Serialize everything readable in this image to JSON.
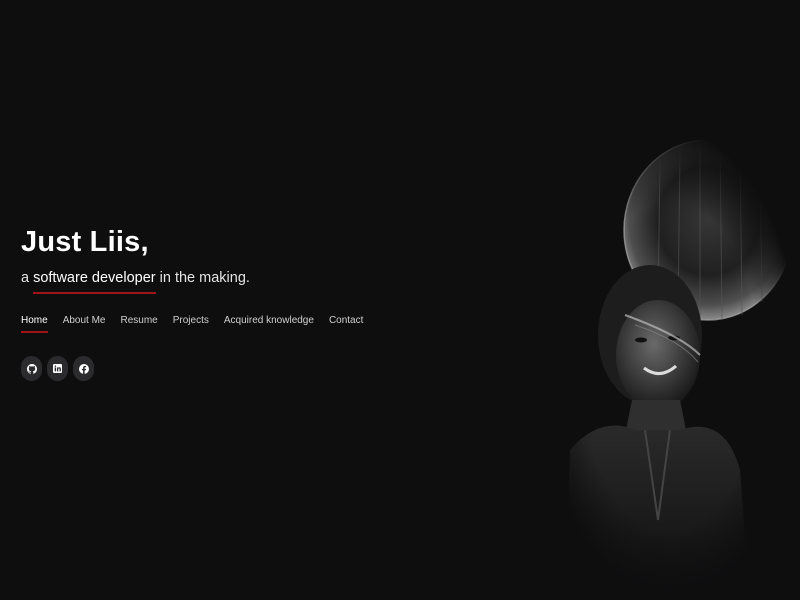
{
  "hero": {
    "name": "Just Liis,",
    "tagline_prefix": "a ",
    "tagline_highlight": "software developer",
    "tagline_suffix": " in the making.",
    "accent_color": "#a11418"
  },
  "nav": {
    "items": [
      {
        "label": "Home",
        "active": true
      },
      {
        "label": "About Me",
        "active": false
      },
      {
        "label": "Resume",
        "active": false
      },
      {
        "label": "Projects",
        "active": false
      },
      {
        "label": "Acquired knowledge",
        "active": false
      },
      {
        "label": "Contact",
        "active": false
      }
    ]
  },
  "socials": [
    {
      "icon": "github-icon"
    },
    {
      "icon": "linkedin-icon"
    },
    {
      "icon": "facebook-icon"
    }
  ],
  "photo": {
    "icon": "portrait-photo"
  }
}
